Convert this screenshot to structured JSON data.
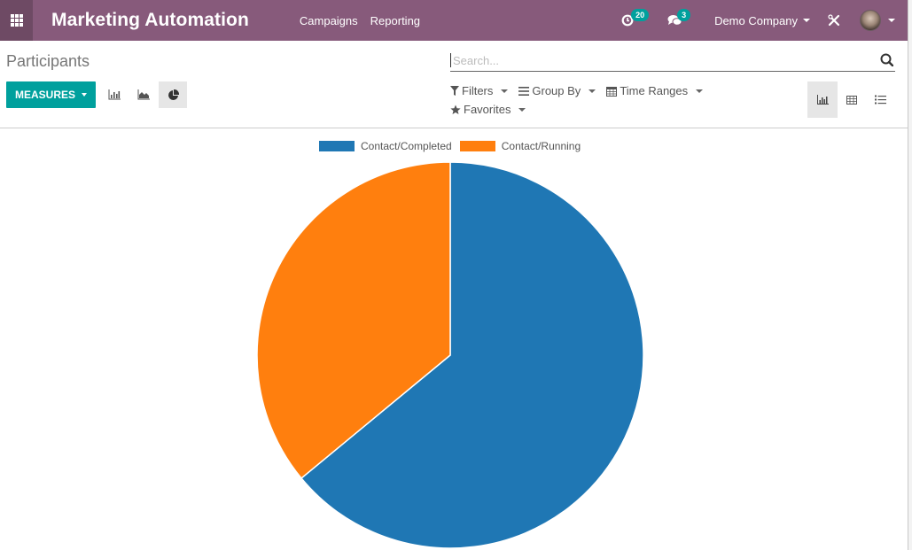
{
  "navbar": {
    "brand": "Marketing Automation",
    "menu": [
      "Campaigns",
      "Reporting"
    ],
    "activity_count": "20",
    "messages_count": "3",
    "company": "Demo Company"
  },
  "control_panel": {
    "title": "Participants",
    "measures_label": "MEASURES",
    "search_placeholder": "Search...",
    "filters_label": "Filters",
    "group_by_label": "Group By",
    "time_ranges_label": "Time Ranges",
    "favorites_label": "Favorites",
    "active_chart_mode": "pie",
    "active_view": "graph"
  },
  "colors": {
    "navbar": "#875a7b",
    "accent": "#00a09d"
  },
  "chart_data": {
    "type": "pie",
    "title": "",
    "legend_position": "top-center",
    "categories": [
      "Contact/Completed",
      "Contact/Running"
    ],
    "values": [
      16,
      9
    ],
    "colors": [
      "#1f77b4",
      "#ff7f0e"
    ]
  }
}
